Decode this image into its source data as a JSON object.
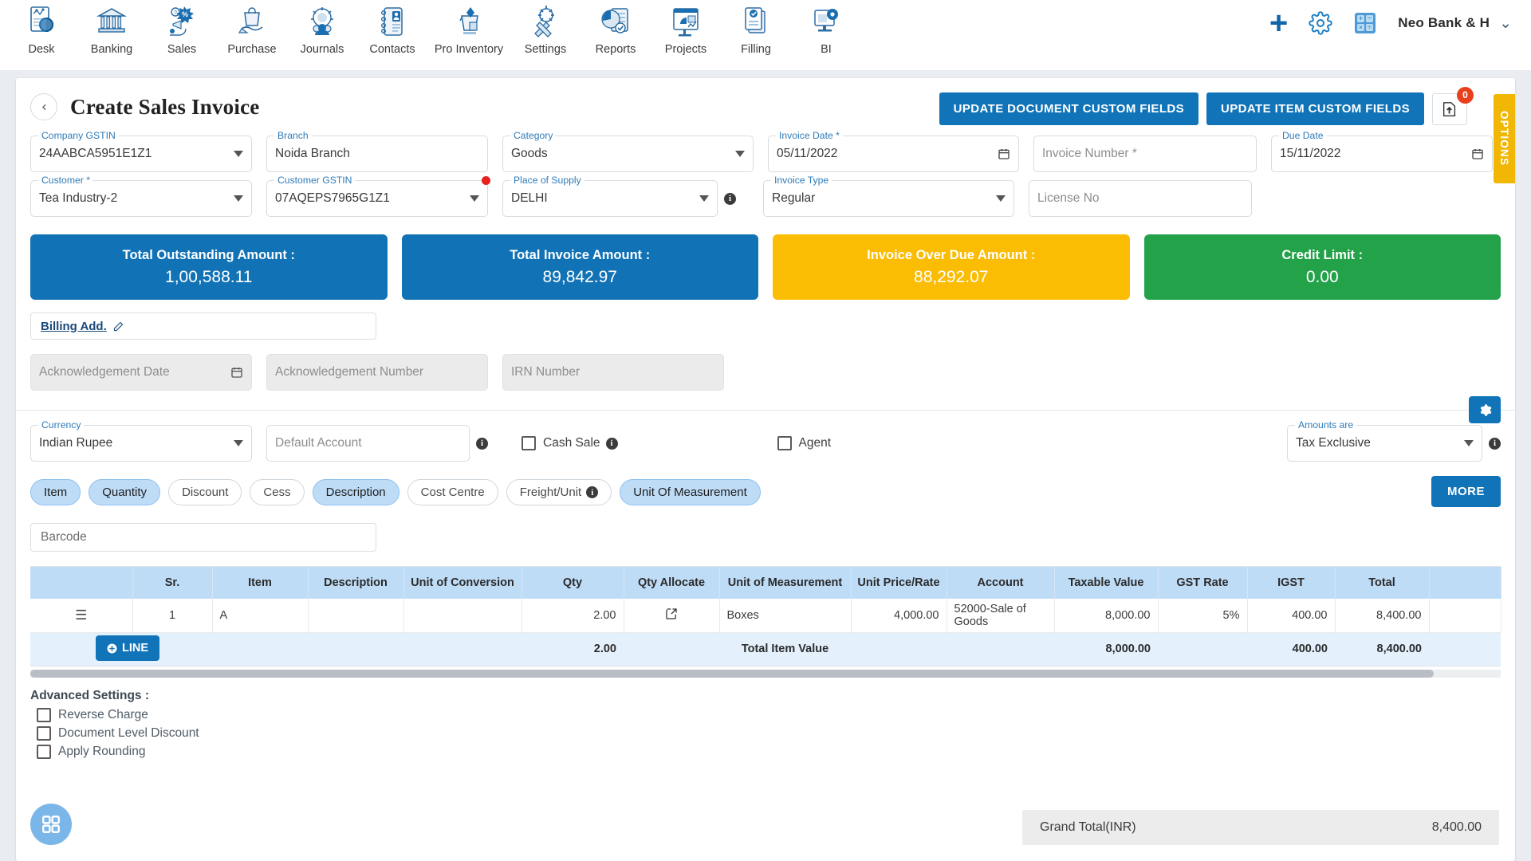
{
  "topnav": {
    "items": [
      {
        "label": "Desk",
        "icon": "desk-icon"
      },
      {
        "label": "Banking",
        "icon": "bank-icon"
      },
      {
        "label": "Sales",
        "icon": "sales-icon"
      },
      {
        "label": "Purchase",
        "icon": "purchase-icon"
      },
      {
        "label": "Journals",
        "icon": "journals-icon"
      },
      {
        "label": "Contacts",
        "icon": "contacts-icon"
      },
      {
        "label": "Pro Inventory",
        "icon": "inventory-icon"
      },
      {
        "label": "Settings",
        "icon": "settings-icon"
      },
      {
        "label": "Reports",
        "icon": "reports-icon"
      },
      {
        "label": "Projects",
        "icon": "projects-icon"
      },
      {
        "label": "Filling",
        "icon": "filling-icon"
      },
      {
        "label": "BI",
        "icon": "bi-icon"
      }
    ],
    "add_icon": "plus-icon",
    "settings_icon": "gear-icon",
    "calculator_icon": "calculator-icon",
    "org_name": "Neo Bank & H",
    "org_chevron": "chevron-down-icon"
  },
  "header": {
    "back_icon": "chevron-left-icon",
    "title": "Create Sales Invoice",
    "update_document_btn": "UPDATE DOCUMENT CUSTOM FIELDS",
    "update_item_btn": "UPDATE ITEM CUSTOM FIELDS",
    "upload_icon": "upload-document-icon",
    "upload_badge": "0",
    "options_tab": "OPTIONS"
  },
  "form": {
    "company_gstin": {
      "label": "Company GSTIN",
      "value": "24AABCA5951E1Z1"
    },
    "branch": {
      "label": "Branch",
      "value": "Noida Branch"
    },
    "category": {
      "label": "Category",
      "value": "Goods"
    },
    "invoice_date": {
      "label": "Invoice Date *",
      "value": "05/11/2022"
    },
    "invoice_number": {
      "label": "",
      "placeholder": "Invoice Number *",
      "value": ""
    },
    "due_date": {
      "label": "Due Date",
      "value": "15/11/2022"
    },
    "customer": {
      "label": "Customer *",
      "value": "Tea Industry-2"
    },
    "customer_gstin": {
      "label": "Customer GSTIN",
      "value": "07AQEPS7965G1Z1"
    },
    "place_of_supply": {
      "label": "Place of Supply",
      "value": "DELHI"
    },
    "invoice_type": {
      "label": "Invoice Type",
      "value": "Regular"
    },
    "license_no": {
      "label": "",
      "placeholder": "License No",
      "value": ""
    }
  },
  "summary": [
    {
      "title": "Total Outstanding Amount :",
      "value": "1,00,588.11",
      "color": "#1172b5"
    },
    {
      "title": "Total Invoice Amount :",
      "value": "89,842.97",
      "color": "#1172b5"
    },
    {
      "title": "Invoice Over Due Amount :",
      "value": "88,292.07",
      "color": "#fbbc04"
    },
    {
      "title": "Credit Limit :",
      "value": "0.00",
      "color": "#23a24a"
    }
  ],
  "billing": {
    "link": "Billing Add.",
    "edit_icon": "edit-icon"
  },
  "acknowledgement": {
    "date_placeholder": "Acknowledgement Date",
    "number_placeholder": "Acknowledgement Number",
    "irn_placeholder": "IRN Number"
  },
  "currency_row": {
    "currency": {
      "label": "Currency",
      "value": "Indian Rupee"
    },
    "default_account": {
      "placeholder": "Default Account",
      "value": ""
    },
    "cash_sale": {
      "label": "Cash Sale",
      "checked": false
    },
    "agent": {
      "label": "Agent",
      "checked": false
    },
    "amounts_are": {
      "label": "Amounts are",
      "value": "Tax Exclusive"
    },
    "gear_icon": "gear-icon"
  },
  "chips": [
    {
      "label": "Item",
      "active": true,
      "info": false
    },
    {
      "label": "Quantity",
      "active": true,
      "info": false
    },
    {
      "label": "Discount",
      "active": false,
      "info": false
    },
    {
      "label": "Cess",
      "active": false,
      "info": false
    },
    {
      "label": "Description",
      "active": true,
      "info": false
    },
    {
      "label": "Cost Centre",
      "active": false,
      "info": false
    },
    {
      "label": "Freight/Unit",
      "active": false,
      "info": true
    },
    {
      "label": "Unit Of Measurement",
      "active": true,
      "info": false
    }
  ],
  "more_button": "MORE",
  "barcode": {
    "placeholder": "Barcode",
    "value": ""
  },
  "table": {
    "columns": [
      "",
      "Sr.",
      "Item",
      "Description",
      "Unit of Conversion",
      "Qty",
      "Qty Allocate",
      "Unit of Measurement",
      "Unit Price/Rate",
      "Account",
      "Taxable Value",
      "GST Rate",
      "IGST",
      "Total"
    ],
    "rows": [
      {
        "handle": "drag-handle-icon",
        "sr": "1",
        "item": "A",
        "description": "",
        "unit_of_conversion": "",
        "qty": "2.00",
        "qty_allocate": "external-link-icon",
        "unit_of_measurement": "Boxes",
        "unit_price": "4,000.00",
        "account": "52000-Sale of Goods",
        "taxable_value": "8,000.00",
        "gst_rate": "5%",
        "igst": "400.00",
        "total": "8,400.00"
      }
    ],
    "totals": {
      "add_line": "LINE",
      "qty": "2.00",
      "label": "Total Item Value",
      "taxable_value": "8,000.00",
      "igst": "400.00",
      "total": "8,400.00"
    }
  },
  "advanced": {
    "title": "Advanced Settings :",
    "items": [
      {
        "label": "Reverse Charge",
        "checked": false
      },
      {
        "label": "Document Level Discount",
        "checked": false
      },
      {
        "label": "Apply Rounding",
        "checked": false
      }
    ]
  },
  "grand_total": {
    "label": "Grand Total(INR)",
    "value": "8,400.00"
  },
  "fab": {
    "icon": "grid-apps-icon"
  }
}
